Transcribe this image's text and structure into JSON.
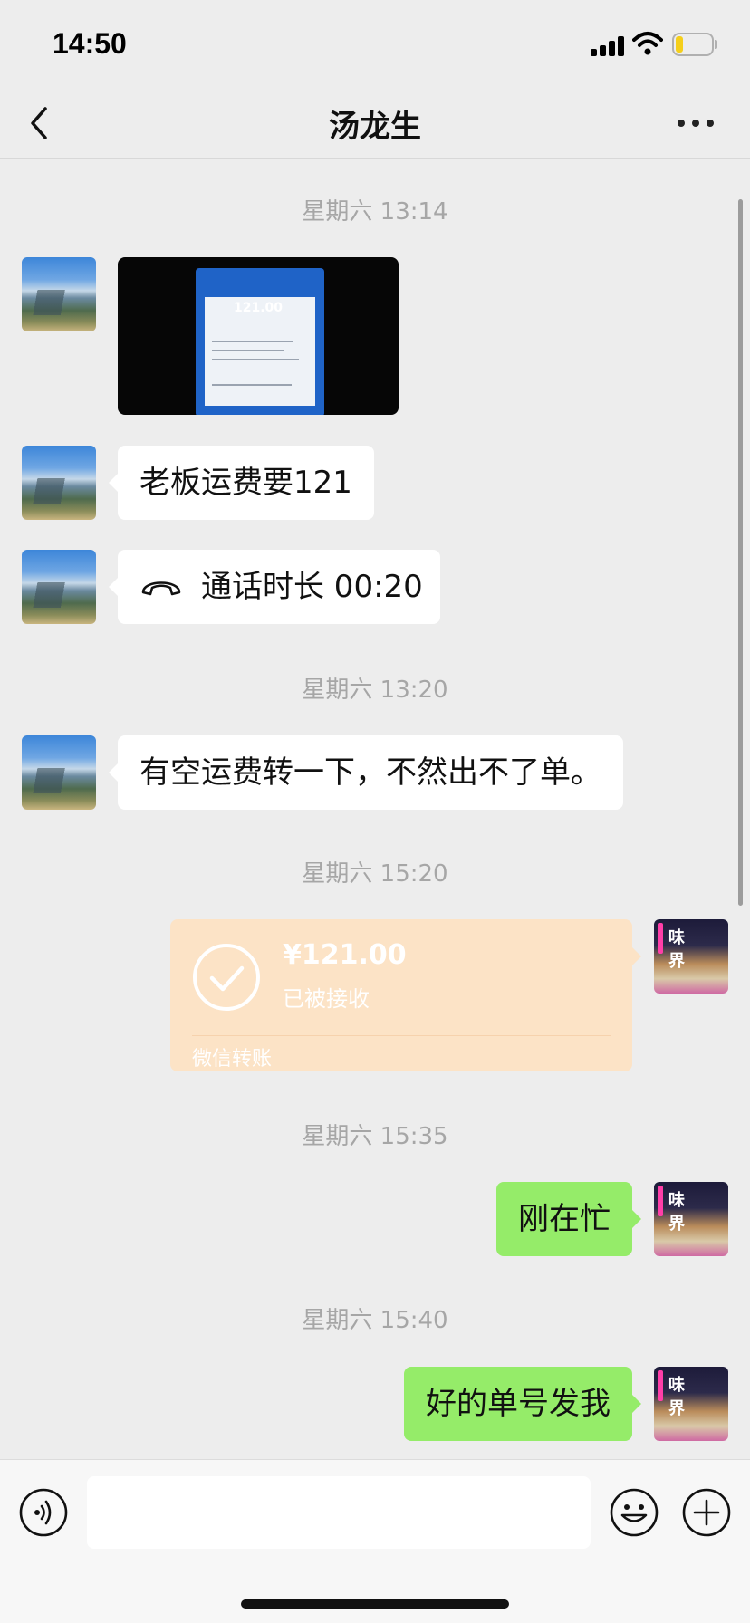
{
  "status_bar": {
    "time": "14:50"
  },
  "header": {
    "title": "汤龙生"
  },
  "chat": {
    "messages": [
      {
        "type": "timestamp",
        "text": "星期六 13:14"
      },
      {
        "type": "image",
        "sender": "other",
        "photo": {
          "amount": "121.00"
        }
      },
      {
        "type": "text",
        "sender": "other",
        "text": "老板运费要121"
      },
      {
        "type": "call",
        "sender": "other",
        "text": "通话时长 00:20"
      },
      {
        "type": "timestamp",
        "text": "星期六 13:20"
      },
      {
        "type": "text",
        "sender": "other",
        "text": "有空运费转一下，不然出不了单。"
      },
      {
        "type": "timestamp",
        "text": "星期六 15:20"
      },
      {
        "type": "transfer",
        "sender": "me",
        "amount": "¥121.00",
        "status": "已被接收",
        "footer": "微信转账"
      },
      {
        "type": "timestamp",
        "text": "星期六 15:35"
      },
      {
        "type": "text",
        "sender": "me",
        "text": "刚在忙"
      },
      {
        "type": "timestamp",
        "text": "星期六 15:40"
      },
      {
        "type": "text",
        "sender": "me",
        "text": "好的单号发我"
      }
    ],
    "my_avatar_sign": "味 界"
  },
  "input_bar": {
    "placeholder": ""
  },
  "colors": {
    "background": "#ededed",
    "bubble_in": "#ffffff",
    "bubble_out": "#95ec69",
    "transfer_received": "#fce3c6",
    "timestamp_text": "#a6a6a6"
  },
  "icons": [
    "back-icon",
    "more-icon",
    "phone-call-icon",
    "check-icon",
    "voice-icon",
    "emoji-icon",
    "plus-icon",
    "signal-icon",
    "wifi-icon",
    "battery-icon"
  ]
}
